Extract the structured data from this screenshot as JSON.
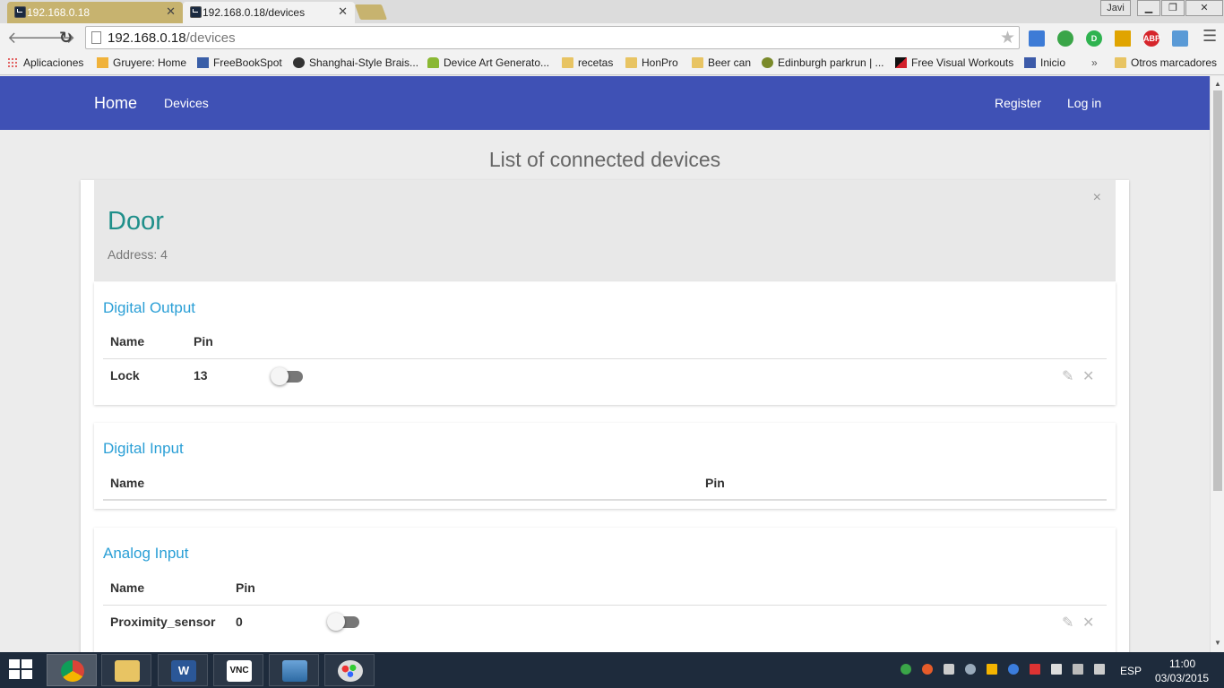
{
  "browser": {
    "tabs": [
      {
        "title": "192.168.0.18"
      },
      {
        "title": "192.168.0.18/devices"
      }
    ],
    "profile": "Javi",
    "url_host": "192.168.0.18",
    "url_path": "/devices",
    "extensions": [
      {
        "label": "",
        "color": "#3d7bd6"
      },
      {
        "label": "",
        "color": "#3aa548"
      },
      {
        "label": "D",
        "color": "#2fb350"
      },
      {
        "label": "",
        "color": "#e0a400"
      },
      {
        "label": "ABP",
        "color": "#d6252b"
      },
      {
        "label": "",
        "color": "#5a9ad6"
      }
    ]
  },
  "bookmarks": [
    {
      "label": "Aplicaciones",
      "icon": "apps-grid-icon"
    },
    {
      "label": "Gruyere: Home",
      "icon": "gruyere-icon"
    },
    {
      "label": "FreeBookSpot",
      "icon": "book-icon"
    },
    {
      "label": "Shanghai-Style Brais...",
      "icon": "bowl-icon"
    },
    {
      "label": "Device Art Generato...",
      "icon": "android-icon"
    },
    {
      "label": "recetas",
      "icon": "folder-icon"
    },
    {
      "label": "HonPro",
      "icon": "folder-icon"
    },
    {
      "label": "Beer can",
      "icon": "folder-icon"
    },
    {
      "label": "Edinburgh parkrun | ...",
      "icon": "parkrun-icon"
    },
    {
      "label": "Free Visual Workouts",
      "icon": "workout-icon"
    },
    {
      "label": "Inicio",
      "icon": "inicio-icon"
    },
    {
      "label": "»",
      "icon": "chevron-double-icon"
    },
    {
      "label": "Otros marcadores",
      "icon": "folder-icon"
    }
  ],
  "site": {
    "brand": "Home",
    "nav_left": "Devices",
    "nav_register": "Register",
    "nav_login": "Log in",
    "page_title": "List of connected devices",
    "colors": {
      "navbar": "#3f51b5",
      "device_name": "#1f8f8a",
      "section_title": "#2a9fd6"
    }
  },
  "device": {
    "name": "Door",
    "address": "Address: 4",
    "close": "×",
    "sections": [
      {
        "title": "Digital Output",
        "headers": [
          "Name",
          "Pin"
        ],
        "rows": [
          {
            "name": "Lock",
            "pin": "13",
            "state": "off"
          }
        ]
      },
      {
        "title": "Digital Input",
        "headers": [
          "Name",
          "Pin"
        ],
        "rows": []
      },
      {
        "title": "Analog Input",
        "headers": [
          "Name",
          "Pin"
        ],
        "rows": [
          {
            "name": "Proximity_sensor",
            "pin": "0",
            "state": "off"
          }
        ]
      }
    ]
  },
  "taskbar": {
    "apps": [
      "chrome-icon",
      "file-explorer-icon",
      "word-icon",
      "vnc-icon",
      "photo-viewer-icon",
      "paint-icon"
    ],
    "word_label": "W",
    "vnc_label": "VNC",
    "language": "ESP",
    "time": "11:00",
    "date": "03/03/2015"
  }
}
